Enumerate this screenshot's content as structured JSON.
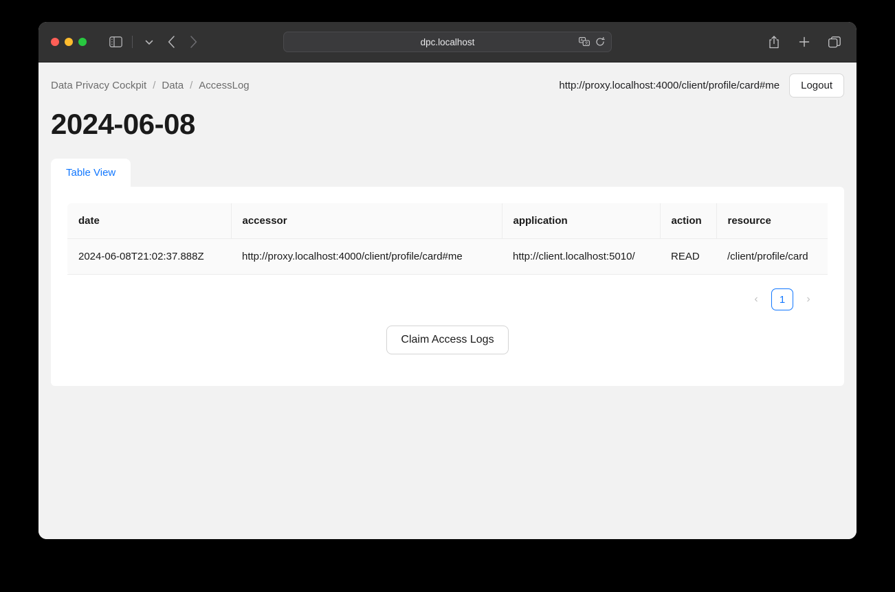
{
  "browser": {
    "url_bar": {
      "value": "dpc.localhost",
      "translate_icon": "translate-icon",
      "reload_icon": "reload-icon"
    },
    "controls": {
      "close": "close-window-button",
      "minimize": "minimize-window-button",
      "maximize": "maximize-window-button",
      "sidebar_icon": "sidebar-toggle-icon",
      "chevron_icon": "chevron-down-icon",
      "back_icon": "back-arrow-icon",
      "forward_icon": "forward-arrow-icon",
      "share_icon": "share-icon",
      "newtab_icon": "plus-icon",
      "tabs_icon": "tab-overview-icon"
    }
  },
  "app": {
    "breadcrumb": [
      "Data Privacy Cockpit",
      "Data",
      "AccessLog"
    ],
    "breadcrumb_separator": "/",
    "user_url": "http://proxy.localhost:4000/client/profile/card#me",
    "logout_label": "Logout",
    "page_title": "2024-06-08",
    "tabs": [
      {
        "label": "Table View",
        "active": true
      }
    ],
    "table": {
      "columns": [
        "date",
        "accessor",
        "application",
        "action",
        "resource"
      ],
      "rows": [
        {
          "date": "2024-06-08T21:02:37.888Z",
          "accessor": "http://proxy.localhost:4000/client/profile/card#me",
          "application": "http://client.localhost:5010/",
          "action": "READ",
          "resource": "/client/profile/card"
        }
      ]
    },
    "pagination": {
      "prev_label": "‹",
      "current_page": "1",
      "next_label": "›"
    },
    "claim_button_label": "Claim Access Logs",
    "colors": {
      "accent": "#1177ff",
      "page_background": "#f2f2f2",
      "panel_background": "#ffffff",
      "table_row_background": "#fafafa",
      "titlebar_background": "#323232"
    }
  }
}
